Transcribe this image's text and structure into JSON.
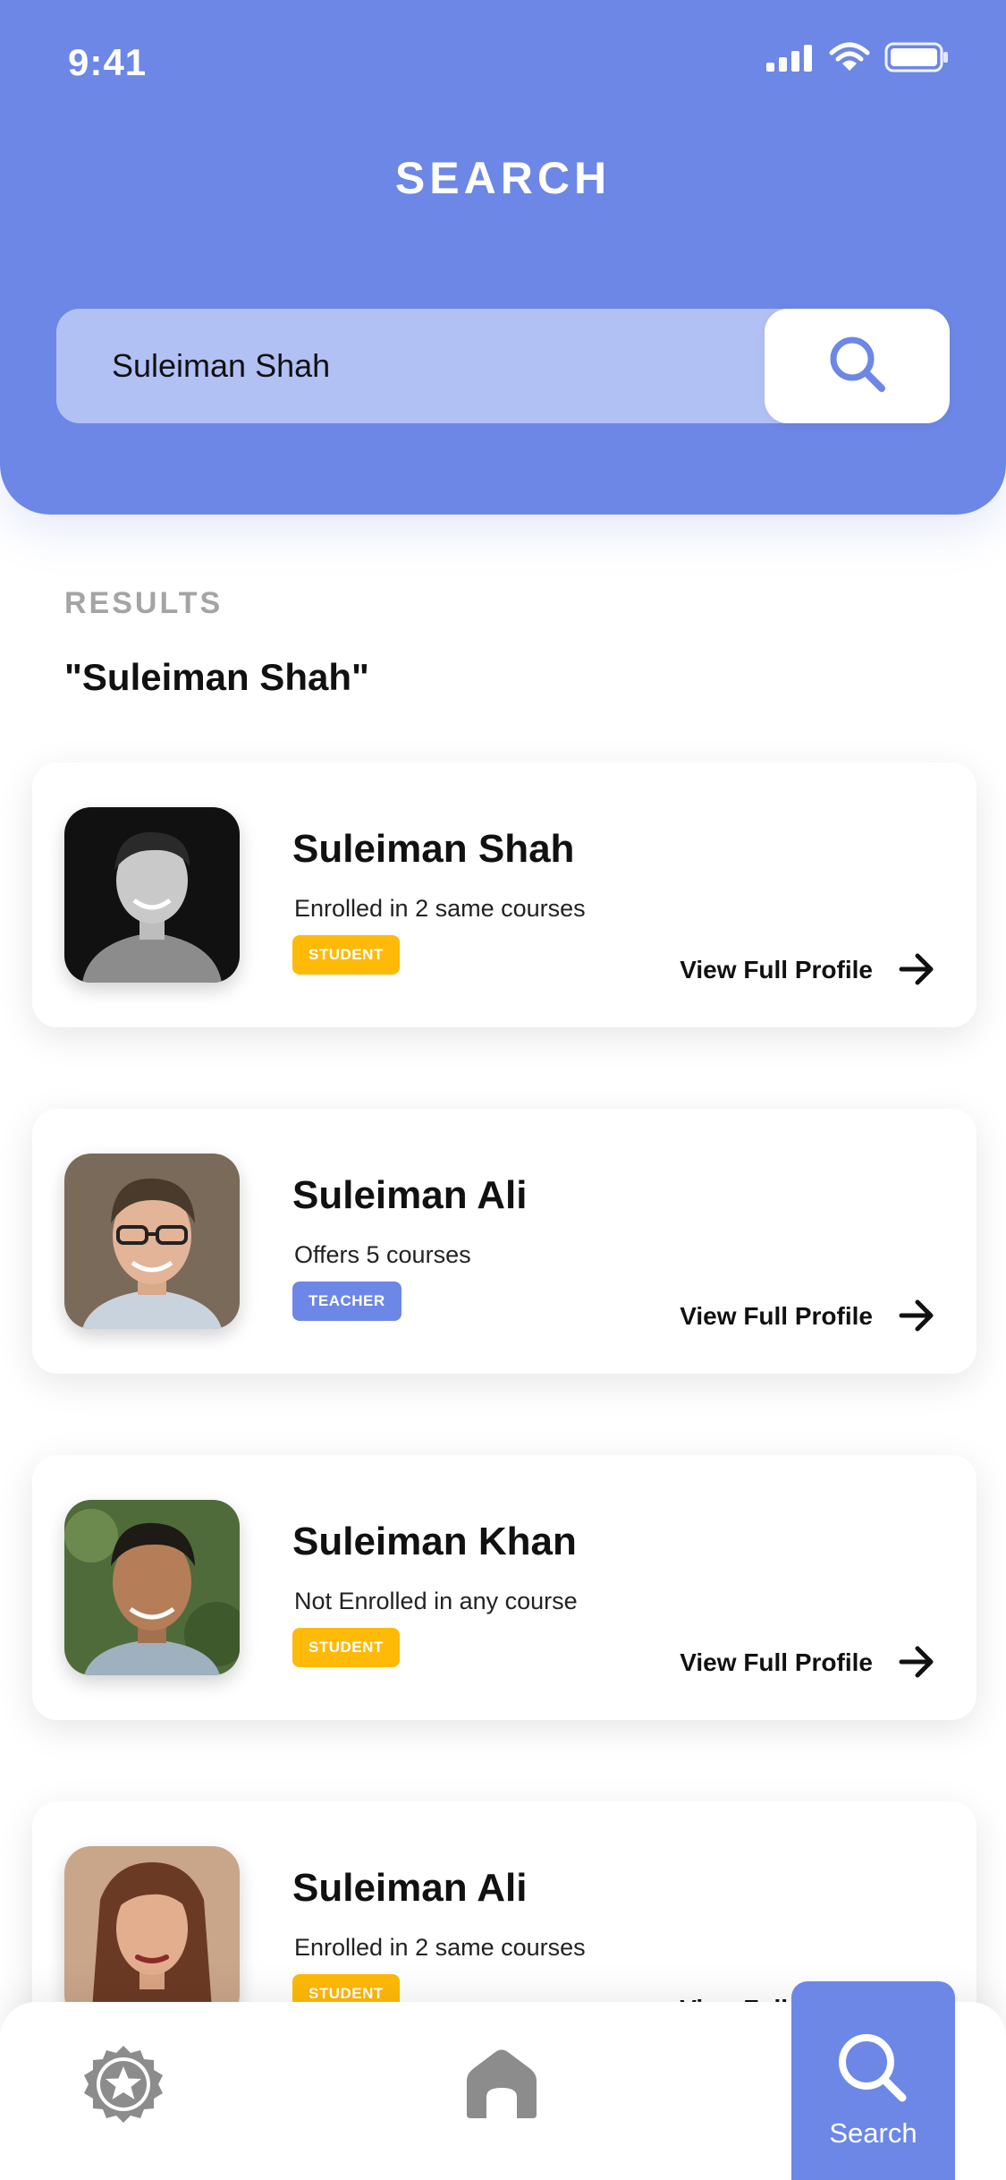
{
  "status_bar": {
    "time": "9:41"
  },
  "header": {
    "title": "SEARCH"
  },
  "search": {
    "value": "Suleiman Shah"
  },
  "results": {
    "label": "RESULTS",
    "query": "\"Suleiman Shah\""
  },
  "cards": [
    {
      "name": "Suleiman Shah",
      "subtitle": "Enrolled in 2 same courses",
      "badge": "STUDENT",
      "link": "View Full Profile"
    },
    {
      "name": "Suleiman Ali",
      "subtitle": "Offers  5 courses",
      "badge": "TEACHER",
      "link": "View Full Profile"
    },
    {
      "name": "Suleiman Khan",
      "subtitle": "Not Enrolled in any course",
      "badge": "STUDENT",
      "link": "View Full Profile"
    },
    {
      "name": "Suleiman Ali",
      "subtitle": "Enrolled in 2 same courses",
      "badge": "STUDENT",
      "link": "View Full Profile"
    }
  ],
  "bottom_nav": {
    "items": [
      {
        "icon": "star-badge-icon"
      },
      {
        "icon": "home-icon"
      },
      {
        "icon": "search-icon",
        "label": "Search",
        "active": true
      }
    ]
  },
  "colors": {
    "primary": "#6D87E6",
    "search_field": "#B2C1F4",
    "student_badge": "#FFBA07",
    "teacher_badge": "#6D87E6",
    "muted_text": "#A4A4A4"
  }
}
